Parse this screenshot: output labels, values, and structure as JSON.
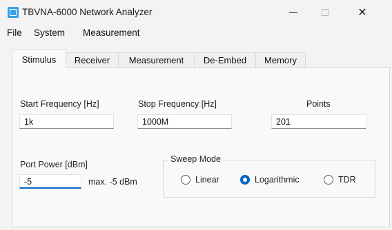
{
  "window": {
    "title": "TBVNA-6000 Network Analyzer",
    "icon": "app-icon",
    "controls": {
      "minimize": "—",
      "maximize": "",
      "close": "✕"
    }
  },
  "menubar": {
    "items": [
      "File",
      "System",
      "Measurement"
    ]
  },
  "tabs": [
    {
      "label": "Stimulus",
      "active": true
    },
    {
      "label": "Receiver",
      "active": false
    },
    {
      "label": "Measurement",
      "active": false
    },
    {
      "label": "De-Embed",
      "active": false
    },
    {
      "label": "Memory",
      "active": false
    }
  ],
  "stimulus": {
    "start_frequency": {
      "label": "Start Frequency [Hz]",
      "value": "1k"
    },
    "stop_frequency": {
      "label": "Stop Frequency [Hz]",
      "value": "1000M"
    },
    "points": {
      "label": "Points",
      "value": "201"
    },
    "port_power": {
      "label": "Port  Power [dBm]",
      "value": "-5",
      "max_text": "max.  -5 dBm"
    },
    "sweep_mode": {
      "title": "Sweep Mode",
      "options": [
        {
          "label": "Linear",
          "checked": false
        },
        {
          "label": "Logarithmic",
          "checked": true
        },
        {
          "label": "TDR",
          "checked": false
        }
      ]
    }
  },
  "colors": {
    "accent": "#0067c0",
    "app_icon": "#3aa0e6"
  }
}
